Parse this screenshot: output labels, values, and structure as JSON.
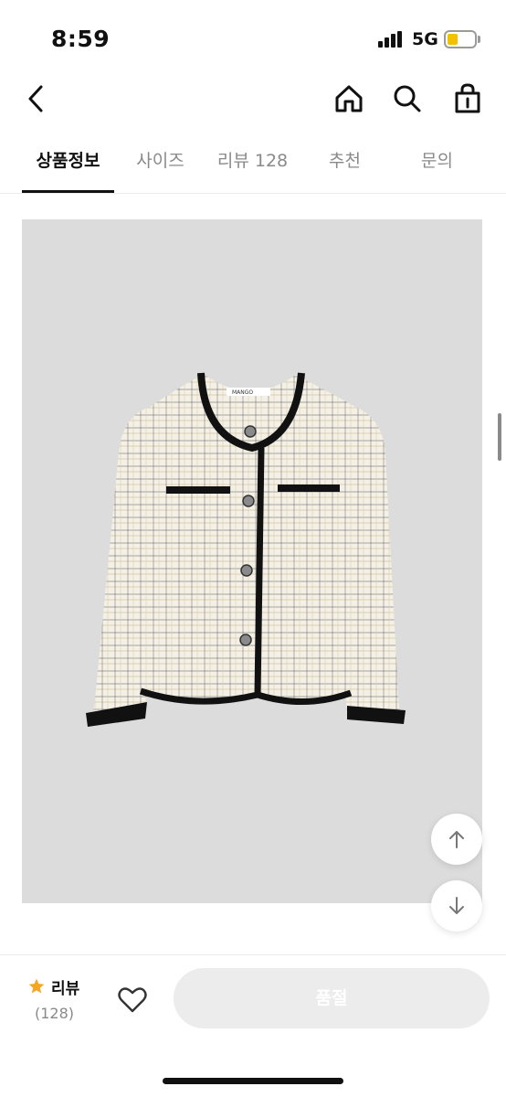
{
  "status_bar": {
    "time": "8:59",
    "network": "5G",
    "battery_color": "#f2c200"
  },
  "header": {
    "back_icon": "chevron-left-icon",
    "home_icon": "home-icon",
    "search_icon": "search-icon",
    "cart_icon": "shopping-bag-icon"
  },
  "tabs": [
    {
      "label": "상품정보",
      "active": true
    },
    {
      "label": "사이즈",
      "active": false
    },
    {
      "label": "리뷰 128",
      "active": false
    },
    {
      "label": "추천",
      "active": false
    },
    {
      "label": "문의",
      "active": false
    }
  ],
  "product": {
    "label_text": "MANGO"
  },
  "floating": {
    "up_icon": "arrow-up-icon",
    "down_icon": "arrow-down-icon"
  },
  "bottom_bar": {
    "review_label": "리뷰",
    "review_count": "(128)",
    "star_color": "#f5a623",
    "wishlist_icon": "heart-icon",
    "button_label": "품절"
  }
}
